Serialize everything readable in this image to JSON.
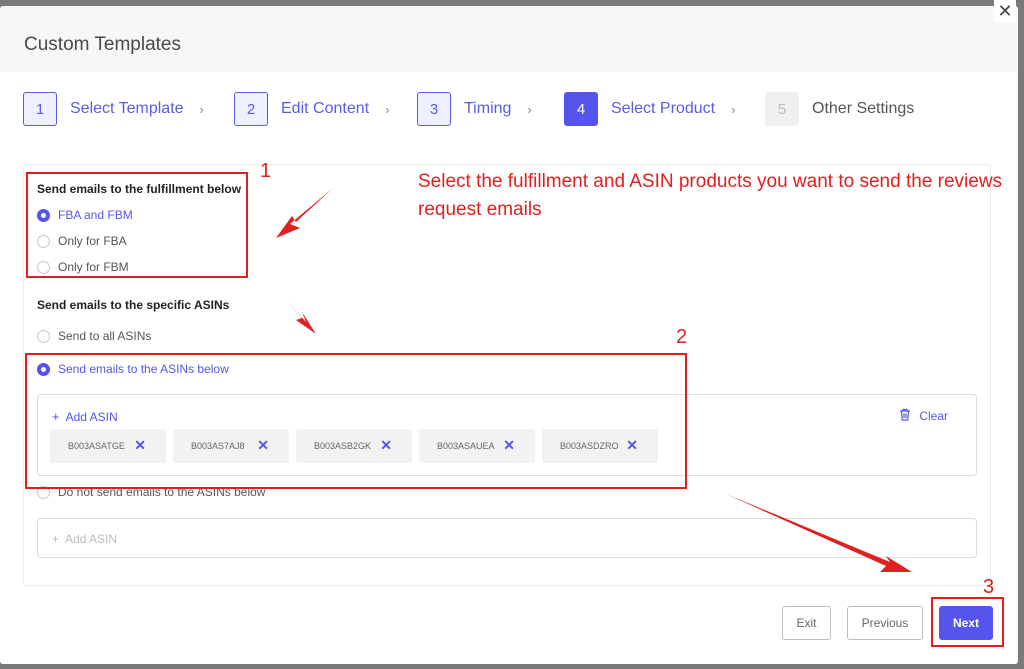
{
  "dialog": {
    "title": "Custom Templates",
    "close_glyph": "✕"
  },
  "steps": [
    {
      "num": "1",
      "label": "Select Template",
      "state": "done"
    },
    {
      "num": "2",
      "label": "Edit Content",
      "state": "done"
    },
    {
      "num": "3",
      "label": "Timing",
      "state": "done"
    },
    {
      "num": "4",
      "label": "Select Product",
      "state": "active"
    },
    {
      "num": "5",
      "label": "Other Settings",
      "state": "disabled"
    }
  ],
  "step_arrow": "›",
  "fulfillment": {
    "title": "Send emails to the fulfillment below",
    "options": [
      {
        "label": "FBA and FBM",
        "checked": true
      },
      {
        "label": "Only for FBA",
        "checked": false
      },
      {
        "label": "Only for FBM",
        "checked": false
      }
    ]
  },
  "asins": {
    "title": "Send emails to the specific ASINs",
    "options": [
      {
        "label": "Send to all ASINs",
        "checked": false
      },
      {
        "label": "Send emails to the ASINs below",
        "checked": true
      },
      {
        "label": "Do not send emails to the ASINs below",
        "checked": false
      }
    ],
    "add_label": "Add ASIN",
    "clear_label": "Clear",
    "chips": [
      "B003ASATGE",
      "B003AS7AJ8",
      "B003ASB2GK",
      "B003ASAUEA",
      "B003ASDZRO"
    ],
    "exclude_add_label": "Add ASIN"
  },
  "footer": {
    "exit_label": "Exit",
    "previous_label": "Previous",
    "next_label": "Next"
  },
  "annotations": {
    "num1": "1",
    "num2": "2",
    "num3": "3",
    "instruction": "Select the fulfillment and ASIN products you want to send the reviews request emails"
  },
  "colors": {
    "accent": "#5555ee",
    "annotation": "#e02020"
  }
}
